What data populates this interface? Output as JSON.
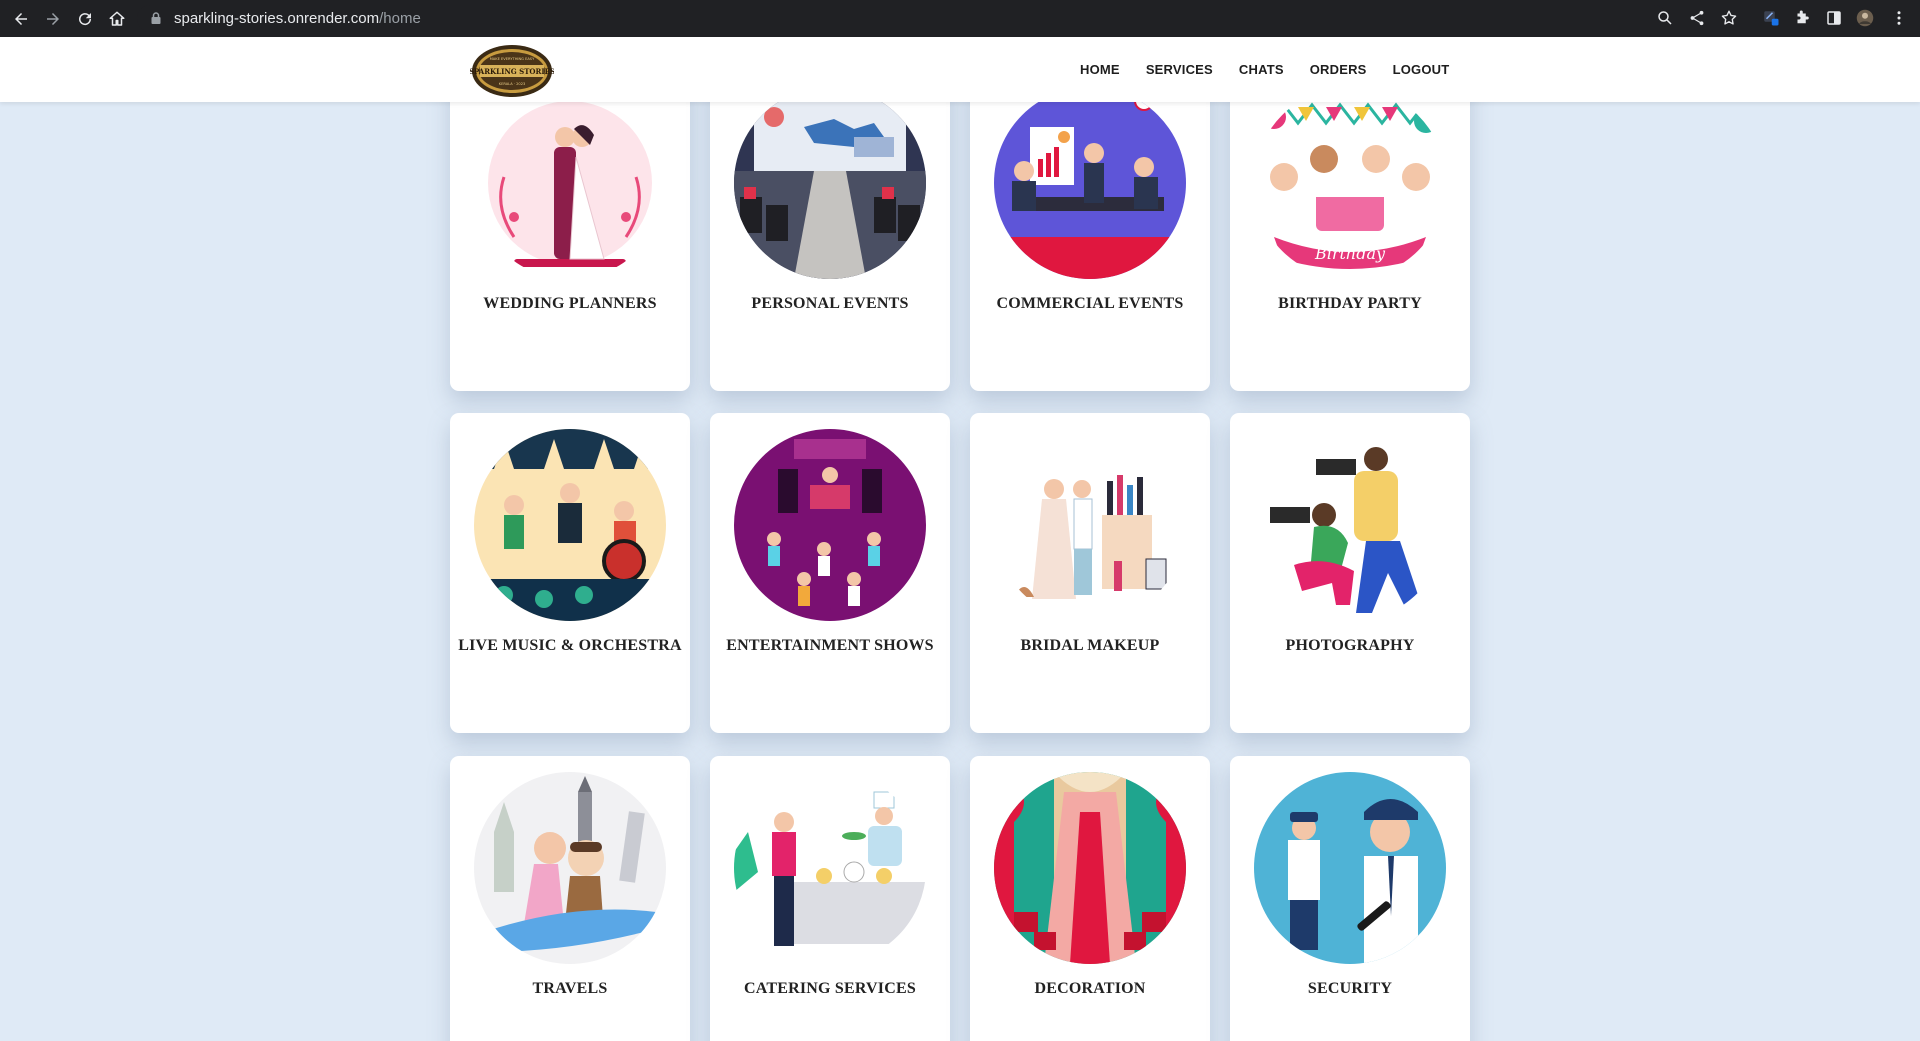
{
  "browser": {
    "url_host": "sparkling-stories.onrender.com",
    "url_path": "/home"
  },
  "site": {
    "logo": {
      "top_text": "MAKE EVERYTHING EASY",
      "name": "SPARKLING STORIES",
      "bottom_text": "KERALA · 2023"
    },
    "nav": [
      "HOME",
      "SERVICES",
      "CHATS",
      "ORDERS",
      "LOGOUT"
    ]
  },
  "services": [
    {
      "label": "WEDDING PLANNERS",
      "icon": "wedding-couple-illustration"
    },
    {
      "label": "PERSONAL EVENTS",
      "icon": "conference-hall-illustration"
    },
    {
      "label": "COMMERCIAL EVENTS",
      "icon": "business-meeting-illustration"
    },
    {
      "label": "BIRTHDAY PARTY",
      "icon": "birthday-cake-illustration"
    },
    {
      "label": "LIVE MUSIC & ORCHESTRA",
      "icon": "concert-band-illustration"
    },
    {
      "label": "ENTERTAINMENT SHOWS",
      "icon": "dance-party-illustration"
    },
    {
      "label": "BRIDAL MAKEUP",
      "icon": "makeup-artist-illustration"
    },
    {
      "label": "PHOTOGRAPHY",
      "icon": "photographers-illustration"
    },
    {
      "label": "TRAVELS",
      "icon": "travel-landmarks-illustration"
    },
    {
      "label": "CATERING SERVICES",
      "icon": "buffet-chef-illustration"
    },
    {
      "label": "DECORATION",
      "icon": "decorated-aisle-illustration"
    },
    {
      "label": "SECURITY",
      "icon": "security-guards-illustration"
    }
  ],
  "colors": {
    "page_background": "#dfeaf6",
    "card_background": "#ffffff",
    "header_background": "#ffffff",
    "chrome_background": "#202124"
  }
}
